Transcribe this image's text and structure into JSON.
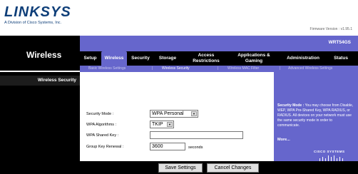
{
  "header": {
    "logo": "LINKSYS",
    "logo_tagline": "A Division of Cisco Systems, Inc.",
    "firmware_label": "Firmware Version : v1.95.1",
    "model": "WRT54GS",
    "section_title": "Wireless"
  },
  "nav": {
    "tabs": [
      {
        "label": "Setup",
        "active": false
      },
      {
        "label": "Wireless",
        "active": true
      },
      {
        "label": "Security",
        "active": false
      },
      {
        "label": "Storage",
        "active": false
      },
      {
        "label": "Access Restrictions",
        "active": false
      },
      {
        "label": "Applications & Gaming",
        "active": false
      },
      {
        "label": "Administration",
        "active": false
      },
      {
        "label": "Status",
        "active": false
      }
    ],
    "subtabs": [
      {
        "label": "Basic Wireless Settings",
        "active": false
      },
      {
        "label": "Wireless Security",
        "active": true
      },
      {
        "label": "Wireless MAC Filter",
        "active": false
      },
      {
        "label": "Advanced Wireless Settings",
        "active": false
      }
    ],
    "separator": "|"
  },
  "left": {
    "heading": "Wireless Security"
  },
  "form": {
    "security_mode_label": "Security Mode :",
    "security_mode_value": "WPA Personal",
    "algorithms_label": "WPA Algorithms :",
    "algorithms_value": "TKIP",
    "shared_key_label": "WPA Shared Key :",
    "shared_key_value": "",
    "renewal_label": "Group Key Renewal :",
    "renewal_value": "3600",
    "renewal_unit": "seconds"
  },
  "help": {
    "title": "Security Mode :",
    "body": "You may choose from Disable, WEP, WPA Pre-Shared Key, WPA RADIUS, or RADIUS. All devices on your network must use the same security mode in order to communicate.",
    "more": "More...",
    "brand": "CISCO SYSTEMS"
  },
  "buttons": {
    "save": "Save Settings",
    "cancel": "Cancel Changes"
  },
  "colors": {
    "accent": "#6666cc",
    "band": "#000000",
    "logo": "#0f3f79"
  }
}
